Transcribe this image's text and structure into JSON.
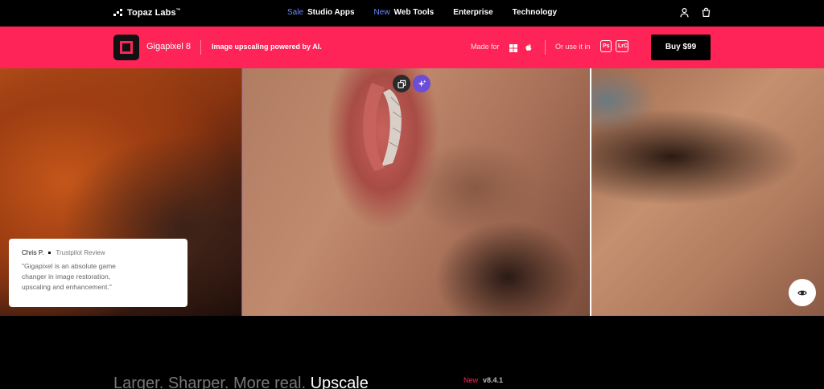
{
  "nav": {
    "brand": "Topaz Labs",
    "brand_tm": "™",
    "links": [
      {
        "tag": "Sale",
        "label": "Studio Apps"
      },
      {
        "tag": "New",
        "label": "Web Tools"
      },
      {
        "tag": "",
        "label": "Enterprise"
      },
      {
        "tag": "",
        "label": "Technology"
      }
    ],
    "icons": [
      "user-icon",
      "bag-icon"
    ]
  },
  "product": {
    "name": "Gigapixel 8",
    "tagline": "Image upscaling powered by AI.",
    "made_for": "Made for",
    "os": [
      "windows-icon",
      "apple-icon"
    ],
    "or_use": "Or use it in",
    "plugins": [
      "Ps",
      "LrC"
    ],
    "buy_label": "Buy  $99"
  },
  "hero": {
    "review": {
      "author": "Chris P.",
      "source": "Trustpilot Review",
      "quote": "\"Gigapixel is an absolute game changer in image restoration, upscaling and enhancement.\""
    },
    "compare_icons": [
      "duplicate-icon",
      "sparkle-icon"
    ],
    "view_icon": "eye-icon"
  },
  "section": {
    "headline_dim": "Larger. Sharper. More real.",
    "headline_bright": "Upscale",
    "new_tag": "New",
    "version": "v8.4.1"
  },
  "colors": {
    "brand_pink": "#ff2457",
    "accent_purple": "#6b4dd8",
    "link_blue": "#6c8cff"
  }
}
